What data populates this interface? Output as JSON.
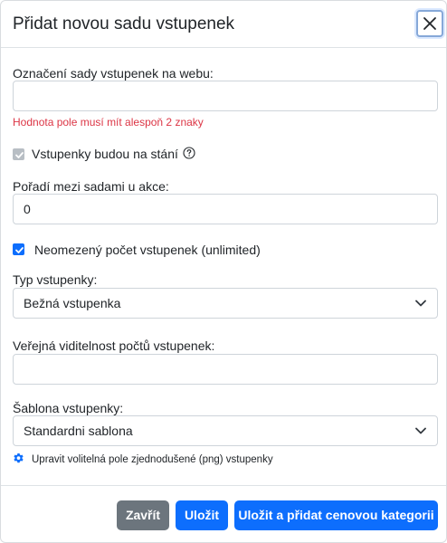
{
  "modal": {
    "title": "Přidat novou sadu vstupenek",
    "close_icon": "close-icon"
  },
  "form": {
    "web_name": {
      "label": "Označení sady vstupenek na webu:",
      "value": "",
      "error": "Hodnota pole musí mít alespoň 2 znaky"
    },
    "standing": {
      "label": "Vstupenky budou na stání",
      "checked": true,
      "disabled": true,
      "help_icon": "question-circle-icon"
    },
    "order": {
      "label": "Pořadí mezi sadami u akce:",
      "value": "0"
    },
    "unlimited": {
      "label": "Neomezený počet vstupenek (unlimited)",
      "checked": true
    },
    "ticket_type": {
      "label": "Typ vstupenky:",
      "selected": "Bežná vstupenka"
    },
    "visibility": {
      "label": "Veřejná viditelnost počtů vstupenek:",
      "value": ""
    },
    "template": {
      "label": "Šablona vstupenky:",
      "selected": "Standardni sablona"
    },
    "optional_fields_link": {
      "icon": "gear-icon",
      "label": "Upravit volitelná pole zjednodušené (png) vstupenky"
    }
  },
  "footer": {
    "close_label": "Zavřít",
    "save_label": "Uložit",
    "save_add_label": "Uložit a přidat cenovou kategorii"
  },
  "colors": {
    "primary": "#0d6efd",
    "secondary": "#6c757d",
    "error": "#dc3545"
  }
}
